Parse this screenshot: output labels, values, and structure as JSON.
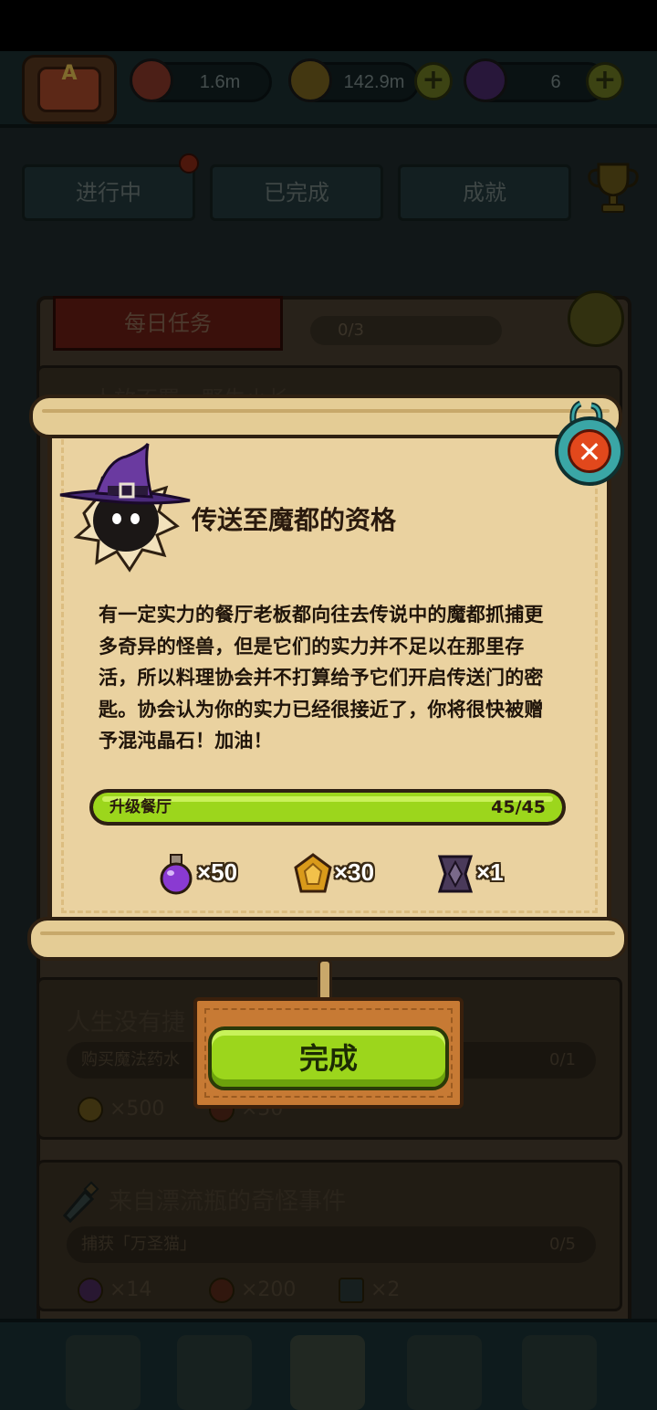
{
  "topbar": {
    "resources": [
      {
        "icon": "eyeball-icon",
        "value": "1.6m"
      },
      {
        "icon": "coin-icon",
        "value": "142.9m"
      },
      {
        "icon": "potion-icon",
        "value": "6"
      }
    ]
  },
  "tabs": [
    {
      "label": "进行中"
    },
    {
      "label": "已完成"
    },
    {
      "label": "成就"
    }
  ],
  "daily": {
    "label": "每日任务",
    "count": "0/3"
  },
  "hidden_task_title": "人放不羁一野生小长",
  "tasks": [
    {
      "title": "人生没有捷",
      "requirement": "购买魔法药水",
      "count": "0/1",
      "rewards": [
        "×500",
        "×50"
      ]
    },
    {
      "title": "来自漂流瓶的奇怪事件",
      "requirement": "捕获「万圣猫」",
      "count": "0/5",
      "rewards": [
        "×14",
        "×200",
        "×2"
      ]
    }
  ],
  "popup": {
    "title": "传送至魔都的资格",
    "description": "有一定实力的餐厅老板都向往去传说中的魔都抓捕更多奇异的怪兽，但是它们的实力并不足以在那里存活，所以料理协会并不打算给予它们开启传送门的密匙。协会认为你的实力已经很接近了，你将很快被赠予混沌晶石！加油！",
    "progress": {
      "label": "升级餐厅",
      "count": "45/45",
      "fraction": 1.0
    },
    "rewards": [
      {
        "icon": "purple-potion-icon",
        "amount": "×50"
      },
      {
        "icon": "amber-gem-icon",
        "amount": "×30"
      },
      {
        "icon": "chaos-crystal-icon",
        "amount": "×1"
      }
    ],
    "complete_button": "完成",
    "colors": {
      "parchment": "#ead2a0",
      "button_green": "#9cd61c",
      "close_red": "#e2481c",
      "close_teal": "#3aa6a6"
    }
  }
}
